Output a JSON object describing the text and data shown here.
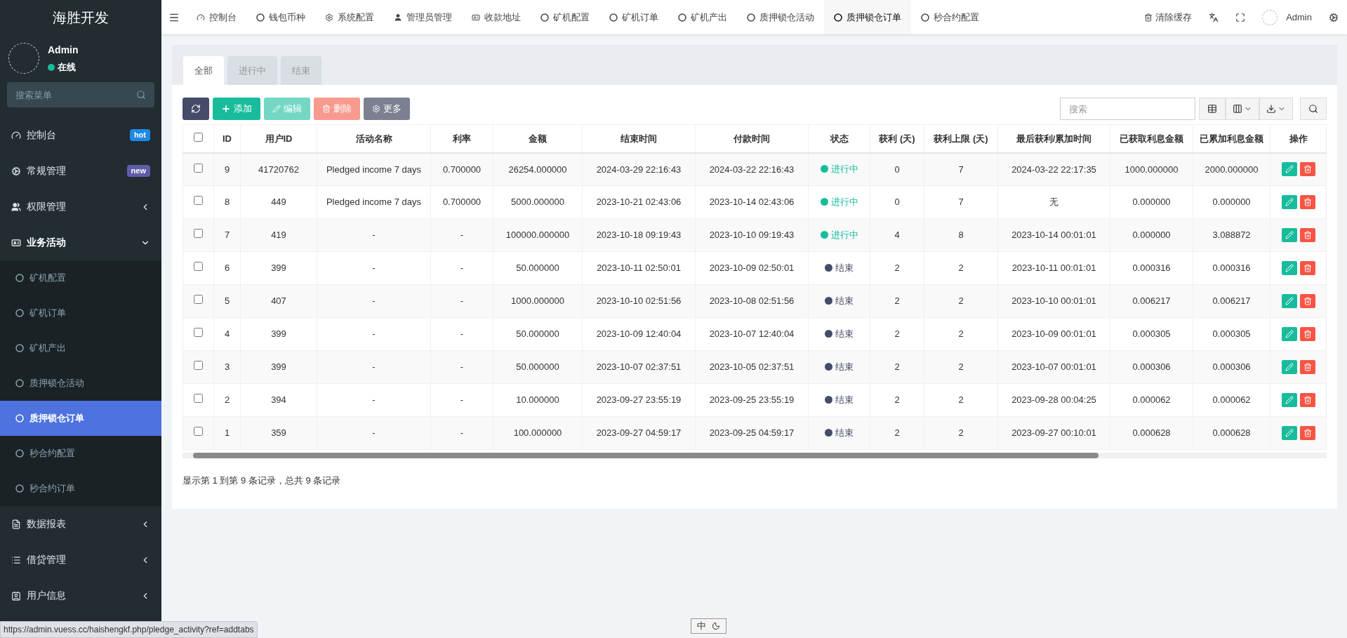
{
  "brand": "海胜开发",
  "user": {
    "name": "Admin",
    "status": "在线"
  },
  "sidebar_search": {
    "placeholder": "搜索菜单"
  },
  "sidebar": [
    {
      "label": "控制台",
      "kind": "dashboard",
      "badge": {
        "text": "hot",
        "color": "#1e88e5"
      },
      "selected": false
    },
    {
      "label": "常规管理",
      "kind": "cogs",
      "badge": {
        "text": "new",
        "color": "#605ca8"
      },
      "selected": false
    },
    {
      "label": "权限管理",
      "kind": "users",
      "expanded": false,
      "selected": false
    },
    {
      "label": "业务活动",
      "kind": "card",
      "expanded": true,
      "selected": false,
      "children": [
        {
          "label": "矿机配置",
          "selected": false
        },
        {
          "label": "矿机订单",
          "selected": false
        },
        {
          "label": "矿机产出",
          "selected": false
        },
        {
          "label": "质押锁仓活动",
          "selected": false
        },
        {
          "label": "质押锁仓订单",
          "selected": true
        },
        {
          "label": "秒合约配置",
          "selected": false
        },
        {
          "label": "秒合约订单",
          "selected": false
        }
      ]
    },
    {
      "label": "数据报表",
      "kind": "file",
      "expanded": false,
      "selected": false
    },
    {
      "label": "借贷管理",
      "kind": "list",
      "expanded": false,
      "selected": false
    },
    {
      "label": "用户信息",
      "kind": "contact",
      "expanded": false,
      "selected": false
    }
  ],
  "top_tabs": [
    {
      "label": "控制台",
      "kind": "dashboard",
      "selected": false
    },
    {
      "label": "钱包币种",
      "kind": "circle",
      "selected": false
    },
    {
      "label": "系统配置",
      "kind": "gear",
      "selected": false
    },
    {
      "label": "管理员管理",
      "kind": "user",
      "selected": false
    },
    {
      "label": "收款地址",
      "kind": "card",
      "selected": false
    },
    {
      "label": "矿机配置",
      "kind": "circle",
      "selected": false
    },
    {
      "label": "矿机订单",
      "kind": "circle",
      "selected": false
    },
    {
      "label": "矿机产出",
      "kind": "circle",
      "selected": false
    },
    {
      "label": "质押锁仓活动",
      "kind": "circle",
      "selected": false
    },
    {
      "label": "质押锁仓订单",
      "kind": "circle",
      "selected": true
    },
    {
      "label": "秒合约配置",
      "kind": "circle",
      "selected": false
    }
  ],
  "top_right": {
    "clear_cache": "清除缓存",
    "user": "Admin"
  },
  "filter_tabs": [
    {
      "label": "全部",
      "selected": true
    },
    {
      "label": "进行中",
      "selected": false
    },
    {
      "label": "结束",
      "selected": false
    }
  ],
  "toolbar": [
    {
      "kind": "refresh",
      "disabled": false
    },
    {
      "kind": "add",
      "label": "添加",
      "disabled": false
    },
    {
      "kind": "edit",
      "label": "编辑",
      "disabled": true
    },
    {
      "kind": "delete",
      "label": "删除",
      "disabled": true
    },
    {
      "kind": "more",
      "label": "更多",
      "disabled": false
    }
  ],
  "search": {
    "placeholder": "搜索"
  },
  "table": {
    "columns": [
      "ID",
      "用户ID",
      "活动名称",
      "利率",
      "金额",
      "结束时间",
      "付款时间",
      "状态",
      "获利 (天)",
      "获利上限 (天)",
      "最后获利/累加时间",
      "已获取利息金额",
      "已累加利息金额",
      "操作"
    ],
    "header_checked": false,
    "rows": [
      {
        "checked": false,
        "cells": [
          "9",
          "41720762",
          "Pledged income 7 days",
          "0.700000",
          "26254.000000",
          "2024-03-29 22:16:43",
          "2024-03-22 22:16:43"
        ],
        "status": {
          "text": "进行中",
          "color": "#18bc9c"
        },
        "cells2": [
          "0",
          "7",
          "2024-03-22 22:17:35",
          "1000.000000",
          "2000.000000"
        ]
      },
      {
        "checked": false,
        "cells": [
          "8",
          "449",
          "Pledged income 7 days",
          "0.700000",
          "5000.000000",
          "2023-10-21 02:43:06",
          "2023-10-14 02:43:06"
        ],
        "status": {
          "text": "进行中",
          "color": "#18bc9c"
        },
        "cells2": [
          "0",
          "7",
          "无",
          "0.000000",
          "0.000000"
        ]
      },
      {
        "checked": false,
        "cells": [
          "7",
          "419",
          "-",
          "-",
          "100000.000000",
          "2023-10-18 09:19:43",
          "2023-10-10 09:19:43"
        ],
        "status": {
          "text": "进行中",
          "color": "#18bc9c"
        },
        "cells2": [
          "4",
          "8",
          "2023-10-14 00:01:01",
          "0.000000",
          "3.088872"
        ]
      },
      {
        "checked": false,
        "cells": [
          "6",
          "399",
          "-",
          "-",
          "50.000000",
          "2023-10-11 02:50:01",
          "2023-10-09 02:50:01"
        ],
        "status": {
          "text": "结束",
          "color": "#444c69"
        },
        "cells2": [
          "2",
          "2",
          "2023-10-11 00:01:01",
          "0.000316",
          "0.000316"
        ]
      },
      {
        "checked": false,
        "cells": [
          "5",
          "407",
          "-",
          "-",
          "1000.000000",
          "2023-10-10 02:51:56",
          "2023-10-08 02:51:56"
        ],
        "status": {
          "text": "结束",
          "color": "#444c69"
        },
        "cells2": [
          "2",
          "2",
          "2023-10-10 00:01:01",
          "0.006217",
          "0.006217"
        ]
      },
      {
        "checked": false,
        "cells": [
          "4",
          "399",
          "-",
          "-",
          "50.000000",
          "2023-10-09 12:40:04",
          "2023-10-07 12:40:04"
        ],
        "status": {
          "text": "结束",
          "color": "#444c69"
        },
        "cells2": [
          "2",
          "2",
          "2023-10-09 00:01:01",
          "0.000305",
          "0.000305"
        ]
      },
      {
        "checked": false,
        "cells": [
          "3",
          "399",
          "-",
          "-",
          "50.000000",
          "2023-10-07 02:37:51",
          "2023-10-05 02:37:51"
        ],
        "status": {
          "text": "结束",
          "color": "#444c69"
        },
        "cells2": [
          "2",
          "2",
          "2023-10-07 00:01:01",
          "0.000306",
          "0.000306"
        ]
      },
      {
        "checked": false,
        "cells": [
          "2",
          "394",
          "-",
          "-",
          "10.000000",
          "2023-09-27 23:55:19",
          "2023-09-25 23:55:19"
        ],
        "status": {
          "text": "结束",
          "color": "#444c69"
        },
        "cells2": [
          "2",
          "2",
          "2023-09-28 00:04:25",
          "0.000062",
          "0.000062"
        ]
      },
      {
        "checked": false,
        "cells": [
          "1",
          "359",
          "-",
          "-",
          "100.000000",
          "2023-09-27 04:59:17",
          "2023-09-25 04:59:17"
        ],
        "status": {
          "text": "结束",
          "color": "#444c69"
        },
        "cells2": [
          "2",
          "2",
          "2023-09-27 00:10:01",
          "0.000628",
          "0.000628"
        ]
      }
    ]
  },
  "pagination_info": "显示第 1 到第 9 条记录，总共 9 条记录",
  "link_preview": "https://admin.vuess.cc/haishengkf.php/pledge_activity?ref=addtabs",
  "ime": "中"
}
